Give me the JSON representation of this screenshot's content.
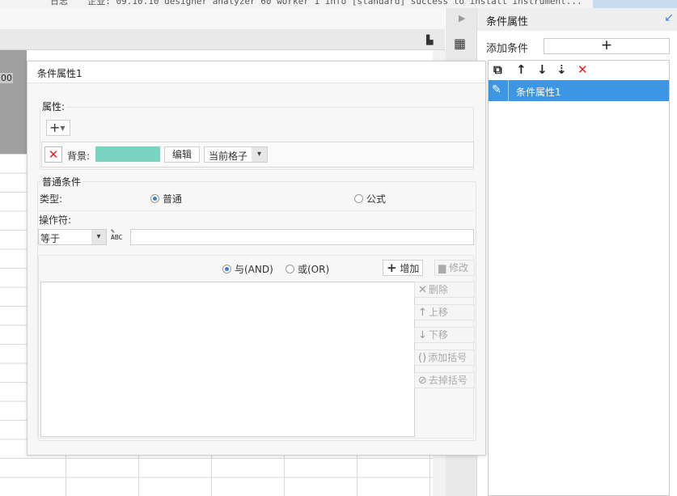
{
  "log": {
    "text": "日志 　 企业: 09.10.10 designer analyzer 60 worker 1 info [standard] success to install instrument..."
  },
  "sheet": {
    "ruler_number": "00"
  },
  "panel": {
    "title": "条件属性",
    "add_label": "添加条件",
    "add_button": "+",
    "items": [
      "条件属性1"
    ],
    "tools": {
      "copy": "⧉",
      "up": "↑",
      "down": "↓",
      "move": "⇣",
      "delete": "✕"
    }
  },
  "dialog": {
    "title": "条件属性1",
    "attr": {
      "legend": "属性:",
      "add_button": "+",
      "row": {
        "label": "背景:",
        "color": "#78d3c0",
        "edit_button": "编辑",
        "scope_value": "当前格子"
      }
    },
    "normal": {
      "legend": "普通条件",
      "type_label": "类型:",
      "type_options": [
        {
          "label": "普通",
          "selected": true
        },
        {
          "label": "公式",
          "selected": false
        }
      ],
      "operator_label": "操作符:",
      "operator_value": "等于",
      "operator_icon_text": "ABC",
      "logic_options": [
        {
          "label": "与(AND)",
          "selected": true
        },
        {
          "label": "或(OR)",
          "selected": false
        }
      ],
      "add_button": "增加",
      "modify_button": "修改",
      "side_buttons": [
        {
          "label": "删除",
          "icon": "✕"
        },
        {
          "label": "上移",
          "icon": "↑"
        },
        {
          "label": "下移",
          "icon": "↓"
        },
        {
          "label": "添加括号",
          "icon": "()"
        },
        {
          "label": "去掉括号",
          "icon": "⊘"
        }
      ]
    }
  }
}
